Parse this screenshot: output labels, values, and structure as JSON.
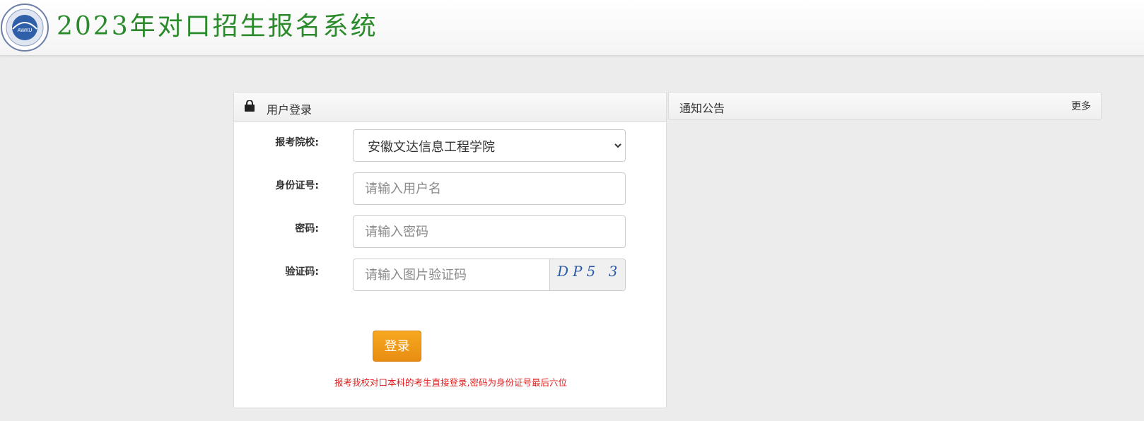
{
  "header": {
    "title": "2023年对口招生报名系统",
    "logo_text": "AWKU"
  },
  "login": {
    "title": "用户登录",
    "school_label": "报考院校:",
    "school_value": "安徽文达信息工程学院",
    "id_label": "身份证号:",
    "id_placeholder": "请输入用户名",
    "password_label": "密码:",
    "password_placeholder": "请输入密码",
    "captcha_label": "验证码:",
    "captcha_placeholder": "请输入图片验证码",
    "captcha_image_text": "DP5 3",
    "submit_label": "登录",
    "hint": "报考我校对口本科的考生直接登录,密码为身份证号最后六位"
  },
  "notice": {
    "title": "通知公告",
    "more_label": "更多"
  },
  "colors": {
    "title_green": "#2b8a2b",
    "button_orange": "#f0a020",
    "hint_red": "#e02020"
  }
}
